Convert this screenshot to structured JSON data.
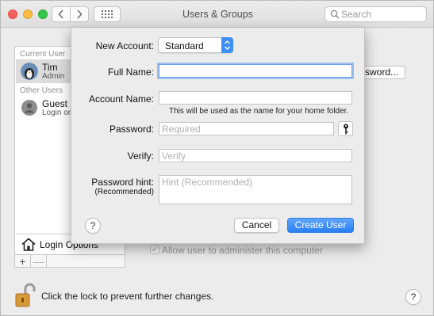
{
  "window": {
    "title": "Users & Groups"
  },
  "toolbar": {
    "search_placeholder": "Search",
    "icons": {
      "back": "chevron-left-icon",
      "forward": "chevron-right-icon",
      "grid": "grid-icon",
      "search": "magnifier-icon"
    }
  },
  "sidebar": {
    "current_user_label": "Current User",
    "other_users_label": "Other Users",
    "users": [
      {
        "name": "Tim",
        "role": "Admin",
        "selected": true
      },
      {
        "name": "Guest U",
        "role": "Login onl",
        "selected": false
      }
    ],
    "login_options_label": "Login Options",
    "add_label": "+",
    "remove_label": "—"
  },
  "background": {
    "change_password_button": "ssword...",
    "allow_admin_label": "Allow user to administer this computer",
    "allow_admin_checked": true,
    "lock_text": "Click the lock to prevent further changes.",
    "help_label": "?"
  },
  "sheet": {
    "new_account_label": "New Account:",
    "account_type": "Standard",
    "full_name_label": "Full Name:",
    "full_name_value": "",
    "account_name_label": "Account Name:",
    "account_name_value": "",
    "account_name_note": "This will be used as the name for your home folder.",
    "password_label": "Password:",
    "password_placeholder": "Required",
    "verify_label": "Verify:",
    "verify_placeholder": "Verify",
    "hint_label": "Password hint:",
    "hint_sublabel": "(Recommended)",
    "hint_placeholder": "Hint (Recommended)",
    "help_label": "?",
    "cancel_label": "Cancel",
    "create_label": "Create User"
  },
  "colors": {
    "accent": "#2a7ff3",
    "focus_ring": "#9dc0ef"
  }
}
